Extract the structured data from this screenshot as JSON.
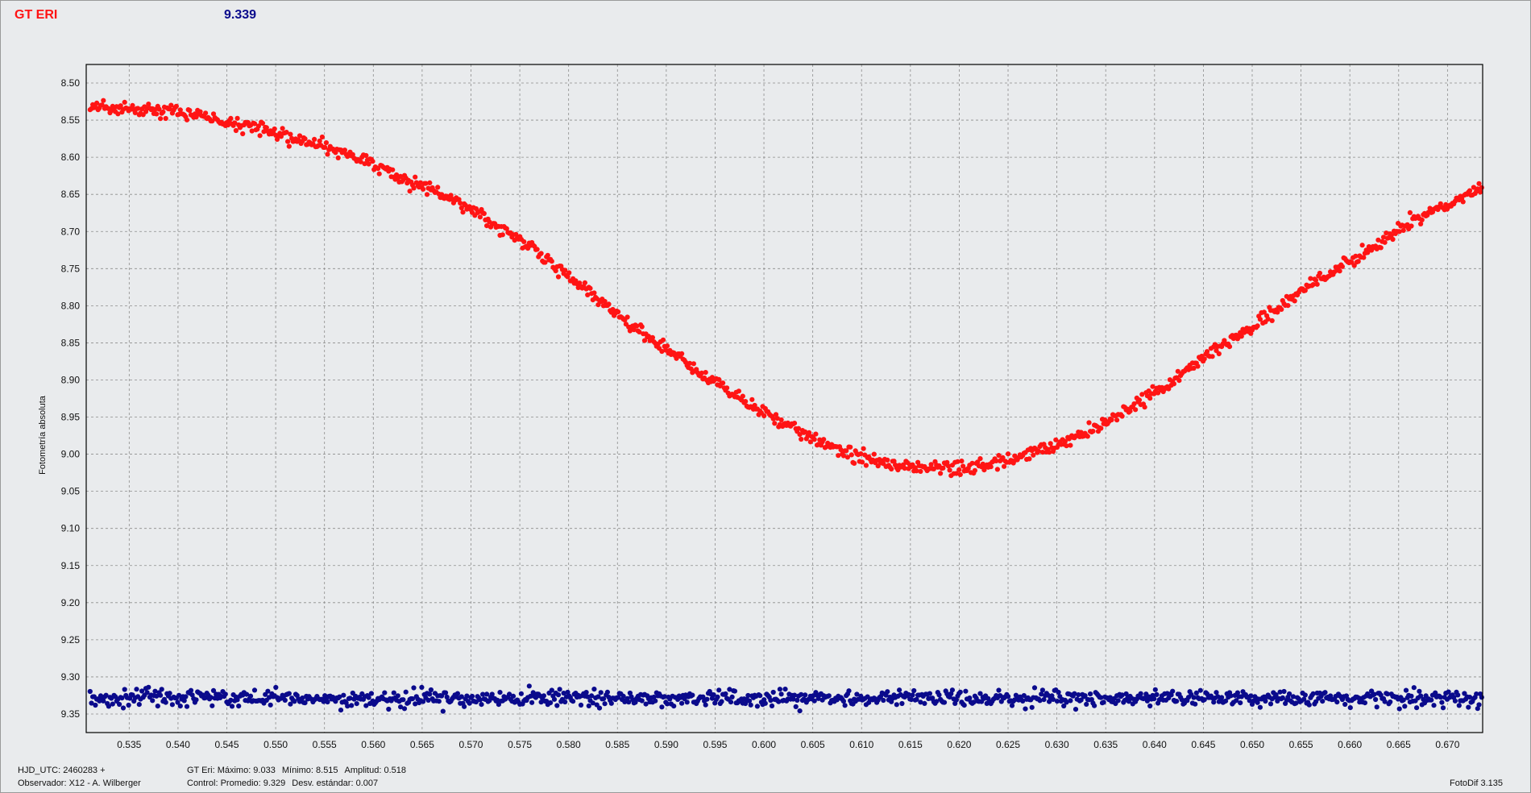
{
  "header": {
    "star_name": "GT ERI",
    "star_value": "9.339"
  },
  "chart_data": {
    "type": "scatter",
    "title": "",
    "xlabel": "",
    "ylabel": "Fotometría absoluta",
    "xlim": [
      0.5306,
      0.6736
    ],
    "ylim": [
      8.475,
      9.375
    ],
    "y_inverted": true,
    "grid": true,
    "x_ticks": [
      "0.535",
      "0.540",
      "0.545",
      "0.550",
      "0.555",
      "0.560",
      "0.565",
      "0.570",
      "0.575",
      "0.580",
      "0.585",
      "0.590",
      "0.595",
      "0.600",
      "0.605",
      "0.610",
      "0.615",
      "0.620",
      "0.625",
      "0.630",
      "0.635",
      "0.640",
      "0.645",
      "0.650",
      "0.655",
      "0.660",
      "0.665",
      "0.670"
    ],
    "y_ticks": [
      "8.50",
      "8.55",
      "8.60",
      "8.65",
      "8.70",
      "8.75",
      "8.80",
      "8.85",
      "8.90",
      "8.95",
      "9.00",
      "9.05",
      "9.10",
      "9.15",
      "9.20",
      "9.25",
      "9.30",
      "9.35"
    ],
    "series": [
      {
        "name": "GT Eri",
        "color": "#ff1414",
        "x": [
          0.531,
          0.534,
          0.537,
          0.54,
          0.543,
          0.546,
          0.549,
          0.552,
          0.555,
          0.558,
          0.561,
          0.564,
          0.567,
          0.57,
          0.573,
          0.576,
          0.579,
          0.582,
          0.585,
          0.588,
          0.591,
          0.594,
          0.597,
          0.6,
          0.603,
          0.606,
          0.609,
          0.612,
          0.615,
          0.618,
          0.621,
          0.624,
          0.627,
          0.63,
          0.633,
          0.636,
          0.639,
          0.642,
          0.645,
          0.648,
          0.651,
          0.654,
          0.657,
          0.66,
          0.663,
          0.666,
          0.669,
          0.672,
          0.6735
        ],
        "y": [
          8.53,
          8.535,
          8.535,
          8.54,
          8.545,
          8.555,
          8.565,
          8.575,
          8.585,
          8.6,
          8.615,
          8.635,
          8.65,
          8.67,
          8.695,
          8.72,
          8.75,
          8.78,
          8.81,
          8.84,
          8.865,
          8.895,
          8.92,
          8.945,
          8.965,
          8.985,
          9.0,
          9.01,
          9.018,
          9.02,
          9.018,
          9.012,
          9.0,
          8.99,
          8.97,
          8.95,
          8.925,
          8.9,
          8.87,
          8.845,
          8.82,
          8.79,
          8.765,
          8.74,
          8.715,
          8.69,
          8.67,
          8.65,
          8.645
        ]
      },
      {
        "name": "Control",
        "color": "#0a0a8c",
        "x": [
          0.531,
          0.6735
        ],
        "y": [
          9.329,
          9.329
        ],
        "std": 0.007
      }
    ]
  },
  "footer": {
    "hjd": "HJD_UTC: 2460283 +",
    "observer": "Observador: X12 - A. Wilberger",
    "gt_label": "GT Eri: Máximo: 9.033",
    "gt_min": "Mínimo: 8.515",
    "gt_amp": "Amplitud: 0.518",
    "control_label": "Control: Promedio: 9.329",
    "control_std": "Desv. estándar: 0.007",
    "version": "FotoDif 3.135"
  }
}
